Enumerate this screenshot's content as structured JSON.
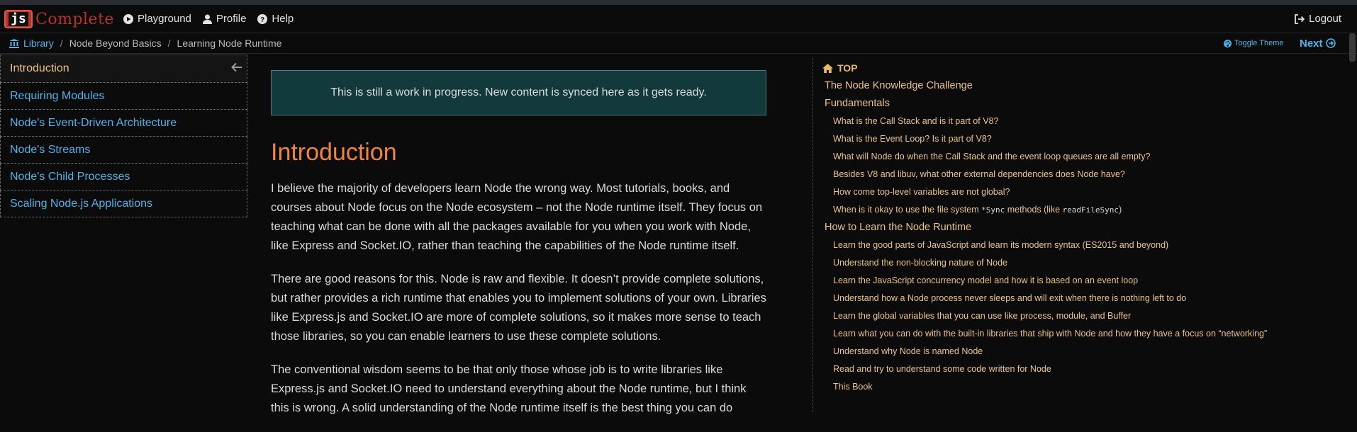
{
  "logo": {
    "mark": "js",
    "name": "Complete"
  },
  "nav": {
    "playground": "Playground",
    "profile": "Profile",
    "help": "Help",
    "logout": "Logout"
  },
  "breadcrumb": {
    "library": "Library",
    "sep1": "/",
    "course": "Node Beyond Basics",
    "sep2": "/",
    "page": "Learning Node Runtime"
  },
  "toolbar": {
    "toggle_theme": "Toggle Theme",
    "next": "Next"
  },
  "sidebar": {
    "items": [
      {
        "label": "Introduction"
      },
      {
        "label": "Requiring Modules"
      },
      {
        "label": "Node's Event-Driven Architecture"
      },
      {
        "label": "Node's Streams"
      },
      {
        "label": "Node's Child Processes"
      },
      {
        "label": "Scaling Node.js Applications"
      }
    ]
  },
  "main": {
    "notice": "This is still a work in progress. New content is synced here as it gets ready.",
    "title": "Introduction",
    "paragraphs": [
      "I believe the majority of developers learn Node the wrong way. Most tutorials, books, and courses about Node focus on the Node ecosystem – not the Node runtime itself. They focus on teaching what can be done with all the packages available for you when you work with Node, like Express and Socket.IO, rather than teaching the capabilities of the Node runtime itself.",
      "There are good reasons for this. Node is raw and flexible. It doesn’t provide complete solutions, but rather provides a rich runtime that enables you to implement solutions of your own. Libraries like Express.js and Socket.IO are more of complete solutions, so it makes more sense to teach those libraries, so you can enable learners to use these complete solutions.",
      "The conventional wisdom seems to be that only those whose job is to write libraries like Express.js and Socket.IO need to understand everything about the Node runtime, but I think this is wrong. A solid understanding of the Node runtime itself is the best thing you can do"
    ]
  },
  "toc": {
    "top": "TOP",
    "h1": "The Node Knowledge Challenge",
    "h2": "Fundamentals",
    "fundamentals": [
      "What is the Call Stack and is it part of V8?",
      "What is the Event Loop? Is it part of V8?",
      "What will Node do when the Call Stack and the event loop queues are all empty?",
      "Besides V8 and libuv, what other external dependencies does Node have?",
      "How come top-level variables are not global?"
    ],
    "sync_item": {
      "before": "When is it okay to use the file system ",
      "code1": "*Sync",
      "middle": " methods (like ",
      "code2": "readFileSync",
      "after": ")"
    },
    "h3": "How to Learn the Node Runtime",
    "learn": [
      "Learn the good parts of JavaScript and learn its modern syntax (ES2015 and beyond)",
      "Understand the non-blocking nature of Node",
      "Learn the JavaScript concurrency model and how it is based on an event loop",
      "Understand how a Node process never sleeps and will exit when there is nothing left to do",
      "Learn the global variables that you can use like process, module, and Buffer",
      "Learn what you can do with the built-in libraries that ship with Node and how they have a focus on “networking”",
      "Understand why Node is named Node",
      "Read and try to understand some code written for Node",
      "This Book"
    ]
  }
}
